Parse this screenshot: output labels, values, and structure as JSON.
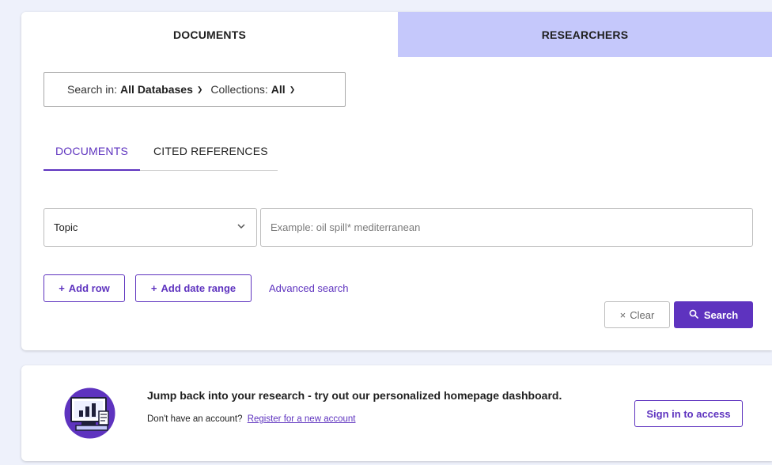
{
  "tabs": {
    "documents": "DOCUMENTS",
    "researchers": "RESEARCHERS"
  },
  "db_selector": {
    "search_in_label": "Search in:",
    "search_in_value": "All Databases",
    "collections_label": "Collections:",
    "collections_value": "All",
    "chevron_icon": "chevron-down-icon"
  },
  "subtabs": {
    "documents": "DOCUMENTS",
    "cited_references": "CITED REFERENCES"
  },
  "query_row": {
    "field_value": "Topic",
    "input_value": "",
    "input_placeholder": "Example: oil spill* mediterranean"
  },
  "actions": {
    "add_row": "Add row",
    "add_date_range": "Add date range",
    "advanced_search": "Advanced search",
    "clear": "Clear",
    "search": "Search",
    "plus_icon": "plus-icon",
    "close_icon": "close-icon",
    "search_icon": "search-icon"
  },
  "promo": {
    "title": "Jump back into your research - try out our personalized homepage dashboard.",
    "no_account_text": "Don't have an account?",
    "register_link": "Register for a new account",
    "sign_in_button": "Sign in to access",
    "icon": "dashboard-illustration-icon"
  },
  "colors": {
    "accent": "#5e33bf",
    "tab_inactive": "#c5c8fb",
    "page_bg": "#eef1fb"
  }
}
